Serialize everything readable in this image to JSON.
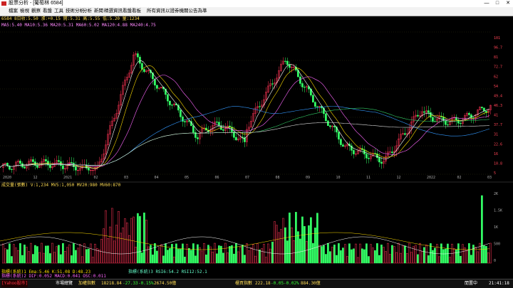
{
  "window": {
    "title": "股票分析 - [葡萄林 6584]",
    "controls": [
      "—",
      "□",
      "✕"
    ]
  },
  "menu": {
    "items": [
      "檔案",
      "檢視",
      "觀察",
      "看盤",
      "工具",
      "技術分析",
      "分析",
      "新聞",
      "精選資訊看盤看板",
      "所有資訊以證券機關公告為準"
    ]
  },
  "info": {
    "line1": "6584  8日收:5.50  漲:+0.15  開:5.31  高:5.55  低:5.20  量:1234",
    "line2": "MA5:5.40  MA10:5.36  MA20:5.31  MA60:5.02  MA120:4.88  MA240:4.75",
    "volume_line": "成交量(張數)  V:1,234  MV5:1,050  MV20:980  MV60:870"
  },
  "price_axis": [
    "101",
    "96.7",
    "81",
    "72.7",
    "62",
    "54",
    "49.4",
    "46.3",
    "41",
    "37.7",
    "31",
    "22.6",
    "16",
    "10.8",
    "5"
  ],
  "volume_axis": [
    "2K",
    "1.5K",
    "1K",
    "500",
    "0"
  ],
  "date_axis": [
    "2020",
    "12",
    "2021",
    "02",
    "03",
    "04",
    "05",
    "06",
    "07",
    "08",
    "09",
    "10",
    "11",
    "12",
    "2022",
    "02",
    "03"
  ],
  "indicators": [
    {
      "text": "指標(系統)1  Ema:5.46  K:51.08  D:48.23",
      "color": "#ffdd00"
    },
    {
      "text": "指標(系統)2  DIF:0.052  MACD:0.041  OSC:0.011",
      "color": "#ff66ff"
    },
    {
      "text": "指標(系統)3  RSI6:54.2  RSI12:52.1",
      "color": "#66ffcc"
    }
  ],
  "bottom": {
    "brand": "[Yahoo股市]",
    "market_label": "市場總覽",
    "index_name": "加權指數",
    "index_value": "18218.84",
    "index_change": "-27.33",
    "index_pct": "-0.15%",
    "volume": "2674.50億",
    "otc_name": "櫃買指數",
    "otc_value": "222.18",
    "otc_change": "-0.05",
    "otc_pct": "-0.02%",
    "otc_volume": "884.30億",
    "mode": "閒置中",
    "clock": "21:41:18"
  },
  "chart_data": {
    "type": "candlestick",
    "price_range": [
      5,
      101
    ],
    "note_only_shape": true
  }
}
